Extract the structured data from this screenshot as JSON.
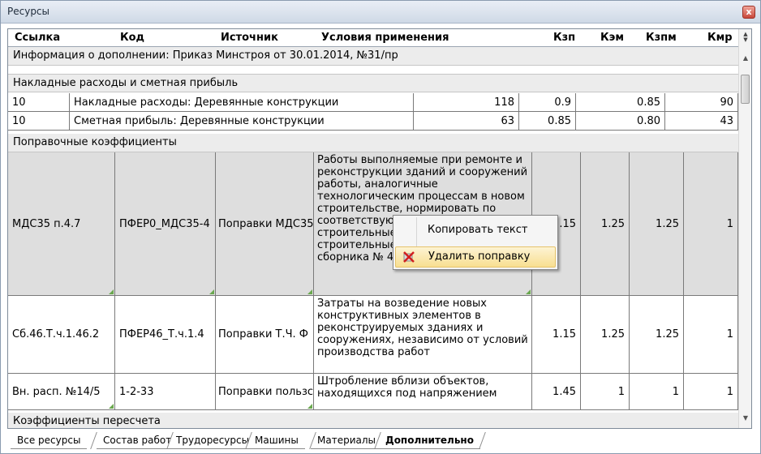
{
  "window": {
    "title": "Ресурсы",
    "close_label": "x"
  },
  "columns": {
    "link": "Ссылка",
    "code": "Код",
    "source": "Источник",
    "conditions": "Условия применения",
    "kzp": "Кзп",
    "kem": "Кэм",
    "kzpm": "Кзпм",
    "kmr": "Кмр"
  },
  "groups": {
    "info": "Информация о дополнении: Приказ Минстроя от 30.01.2014, №31/пр",
    "overhead": "Накладные расходы и сметная прибыль",
    "coefficients": "Поправочные коэффициенты",
    "conversion": "Коэффициенты пересчета"
  },
  "overhead_rows": [
    {
      "link": "10",
      "name": "Накладные расходы: Деревянные конструкции",
      "v1": "118",
      "v2": "0.9",
      "v3": "0.85",
      "v4": "90"
    },
    {
      "link": "10",
      "name": "Сметная прибыль: Деревянные конструкции",
      "v1": "63",
      "v2": "0.85",
      "v3": "0.80",
      "v4": "43"
    }
  ],
  "coef_rows": [
    {
      "link": "МДС35 п.4.7",
      "code": "ПФЕР0_МДС35-4",
      "source": "Поправки МДС35",
      "conditions": "Работы выполняемые при ремонте и реконструкции зданий и сооружений работы, аналогичные технологическим процессам в новом строительстве, нормировать по соответствующим сборникам ФЕР на строительные и монтажные строительные работы (кроме норм сборника № 46)",
      "kzp": ".15",
      "kem": "1.25",
      "kzpm": "1.25",
      "kmr": "1"
    },
    {
      "link": "Сб.46.Т.ч.1.46.2",
      "code": "ПФЕР46_Т.ч.1.4",
      "source": "Поправки Т.Ч. Ф",
      "conditions": "Затраты на возведение новых конструктивных элементов в реконструируемых зданиях и сооружениях, независимо от условий производства работ",
      "kzp": "1.15",
      "kem": "1.25",
      "kzpm": "1.25",
      "kmr": "1"
    },
    {
      "link": "Вн. расп. №14/5",
      "code": "1-2-33",
      "source": "Поправки пользс",
      "conditions": "Штробление вблизи объектов, находящихся под напряжением",
      "kzp": "1.45",
      "kem": "1",
      "kzpm": "1",
      "kmr": "1"
    }
  ],
  "context_menu": {
    "copy": "Копировать текст",
    "delete": "Удалить поправку"
  },
  "tabs": [
    "Все ресурсы",
    "Состав работ",
    "Трудоресурсы",
    "Машины",
    "Материалы",
    "Дополнительно"
  ]
}
